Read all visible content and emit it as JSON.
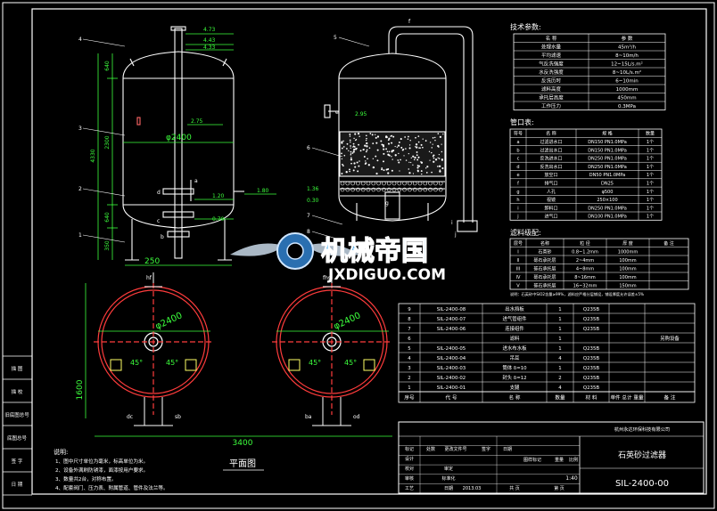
{
  "colors": {
    "background": "#000000",
    "frame": "#ffffff",
    "dimension": "#3cff3c",
    "outline": "#ffffff",
    "plan_outline": "#ff3c3c",
    "center_line": "#ff3c3c",
    "accent": "#ffff66",
    "logo_blue": "#4aa8e8"
  },
  "left_panel": {
    "rows": [
      "描 图",
      "描 校",
      "旧底图总号",
      "底图总号",
      "签 字",
      "日 期"
    ]
  },
  "front_view": {
    "callouts": [
      "4",
      "3",
      "2",
      "1"
    ],
    "dim_top": [
      "4.73",
      "4.43",
      "4.33",
      "2.75",
      "1.20",
      "0.70",
      "1.80"
    ],
    "heights": [
      "640",
      "2300",
      "4330",
      "640",
      "350"
    ],
    "diameter": "φ2400",
    "base_width": "250",
    "nozzle_tags": [
      "d",
      "c",
      "a",
      "b"
    ]
  },
  "section_view": {
    "callouts": [
      "5",
      "6",
      "7",
      "8"
    ],
    "nozzle_tags": [
      "f",
      "e",
      "g"
    ],
    "dims": [
      "2.95",
      "1.36",
      "0.30"
    ],
    "bottom_tags": [
      "i",
      "j"
    ]
  },
  "plan_view": {
    "left_tags": [
      "hf",
      "dc",
      "sb"
    ],
    "right_tags": [
      "fhs",
      "ba",
      "od"
    ],
    "diameter": "φ2400",
    "angles": [
      "45°",
      "45°"
    ],
    "height_dim": "1600",
    "width_dim": "3400",
    "title": "平面图"
  },
  "tech_params": {
    "title": "技术参数:",
    "header": [
      "名 称",
      "参 数"
    ],
    "rows": [
      [
        "处理水量",
        "45m³/h"
      ],
      [
        "平均滤速",
        "8~10m/h"
      ],
      [
        "气反洗强度",
        "12~15L/s.m²"
      ],
      [
        "水反洗强度",
        "8~10L/s.m²"
      ],
      [
        "反洗历时",
        "6~10min"
      ],
      [
        "滤料高度",
        "1000mm"
      ],
      [
        "承托层高度",
        "450mm"
      ],
      [
        "工作压力",
        "0.3MPa"
      ]
    ]
  },
  "nozzle_table": {
    "title": "管口表:",
    "header": [
      "符号",
      "名 称",
      "规 格",
      "数量"
    ],
    "rows": [
      [
        "a",
        "过滤进水口",
        "DN150 PN1.0MPa",
        "1个"
      ],
      [
        "b",
        "过滤出水口",
        "DN150 PN1.0MPa",
        "1个"
      ],
      [
        "c",
        "反洗进水口",
        "DN250 PN1.0MPa",
        "1个"
      ],
      [
        "d",
        "反洗出水口",
        "DN250 PN1.0MPa",
        "1个"
      ],
      [
        "e",
        "放空口",
        "DN50 PN1.0MPa",
        "1个"
      ],
      [
        "f",
        "排气口",
        "DN25",
        "1个"
      ],
      [
        "g",
        "人孔",
        "φ500",
        "1个"
      ],
      [
        "h",
        "视镜",
        "250×100",
        "1个"
      ],
      [
        "i",
        "卸料口",
        "DN250 PN1.0MPa",
        "1个"
      ],
      [
        "j",
        "进气口",
        "DN100 PN1.0MPa",
        "1个"
      ]
    ]
  },
  "media_table": {
    "title": "滤料级配:",
    "header": [
      "层号",
      "名称",
      "粒 径",
      "厚 度",
      "备 注"
    ],
    "rows": [
      [
        "I",
        "石英砂",
        "0.8~1.2mm",
        "1000mm",
        ""
      ],
      [
        "II",
        "砾石承托层",
        "2~4mm",
        "100mm",
        ""
      ],
      [
        "III",
        "砾石承托层",
        "4~8mm",
        "100mm",
        ""
      ],
      [
        "IV",
        "砾石承托层",
        "8~16mm",
        "100mm",
        ""
      ],
      [
        "V",
        "砾石承托层",
        "16~32mm",
        "150mm",
        ""
      ]
    ],
    "note": "说明：石英砂中SiO2含量≥99%，滤料应严格分层铺设，铺设厚度允许误差±5%"
  },
  "parts_list": {
    "rows": [
      [
        "9",
        "SIL-2400-08",
        "出水挡板",
        "1",
        "Q235B",
        "",
        ""
      ],
      [
        "8",
        "SIL-2400-07",
        "进气管组件",
        "1",
        "Q235B",
        "",
        ""
      ],
      [
        "7",
        "SIL-2400-06",
        "连接组件",
        "1",
        "Q235B",
        "",
        ""
      ],
      [
        "6",
        "",
        "滤料",
        "1",
        "",
        "",
        "另购设备"
      ],
      [
        "5",
        "SIL-2400-05",
        "进水布水板",
        "1",
        "Q235B",
        "",
        ""
      ],
      [
        "4",
        "SIL-2400-04",
        "吊耳",
        "4",
        "Q235B",
        "",
        ""
      ],
      [
        "3",
        "SIL-2400-03",
        "筒体 δ=10",
        "1",
        "Q235B",
        "",
        ""
      ],
      [
        "2",
        "SIL-2400-02",
        "封头 δ=12",
        "2",
        "Q235B",
        "",
        ""
      ],
      [
        "1",
        "SIL-2400-01",
        "支腿",
        "4",
        "Q235B",
        "",
        ""
      ]
    ],
    "header": [
      "序号",
      "代 号",
      "名 称",
      "数量",
      "材 料",
      "单件 总计 重量",
      "备 注"
    ]
  },
  "title_block": {
    "company": "杭州永达环保科技有限公司",
    "product": "石英砂过滤器",
    "drawing_no": "SIL-2400-00",
    "scale_label": "比例",
    "scale": "1:40",
    "weight_label": "重量",
    "stage_label": "图样标记",
    "labels": [
      "标记",
      "处数",
      "更改文件号",
      "签字",
      "日期",
      "设计",
      "审核",
      "校对",
      "审定",
      "工艺",
      "标准化",
      "批准",
      "日期"
    ],
    "date": "2013.03",
    "sheet_a": "共 页",
    "sheet_b": "第 页"
  },
  "notes": {
    "title": "说明:",
    "lines": [
      "1、图中尺寸单位为毫米，标高单位为米。",
      "2、设备外满刷防锈漆，面漆按用户要求。",
      "3、数量共2台，对称布置。",
      "4、配套阀门、压力表、附属管道、管件及法兰等。"
    ]
  },
  "watermark": {
    "brand": "机械帝国",
    "site": "JXDIGUO.COM"
  }
}
